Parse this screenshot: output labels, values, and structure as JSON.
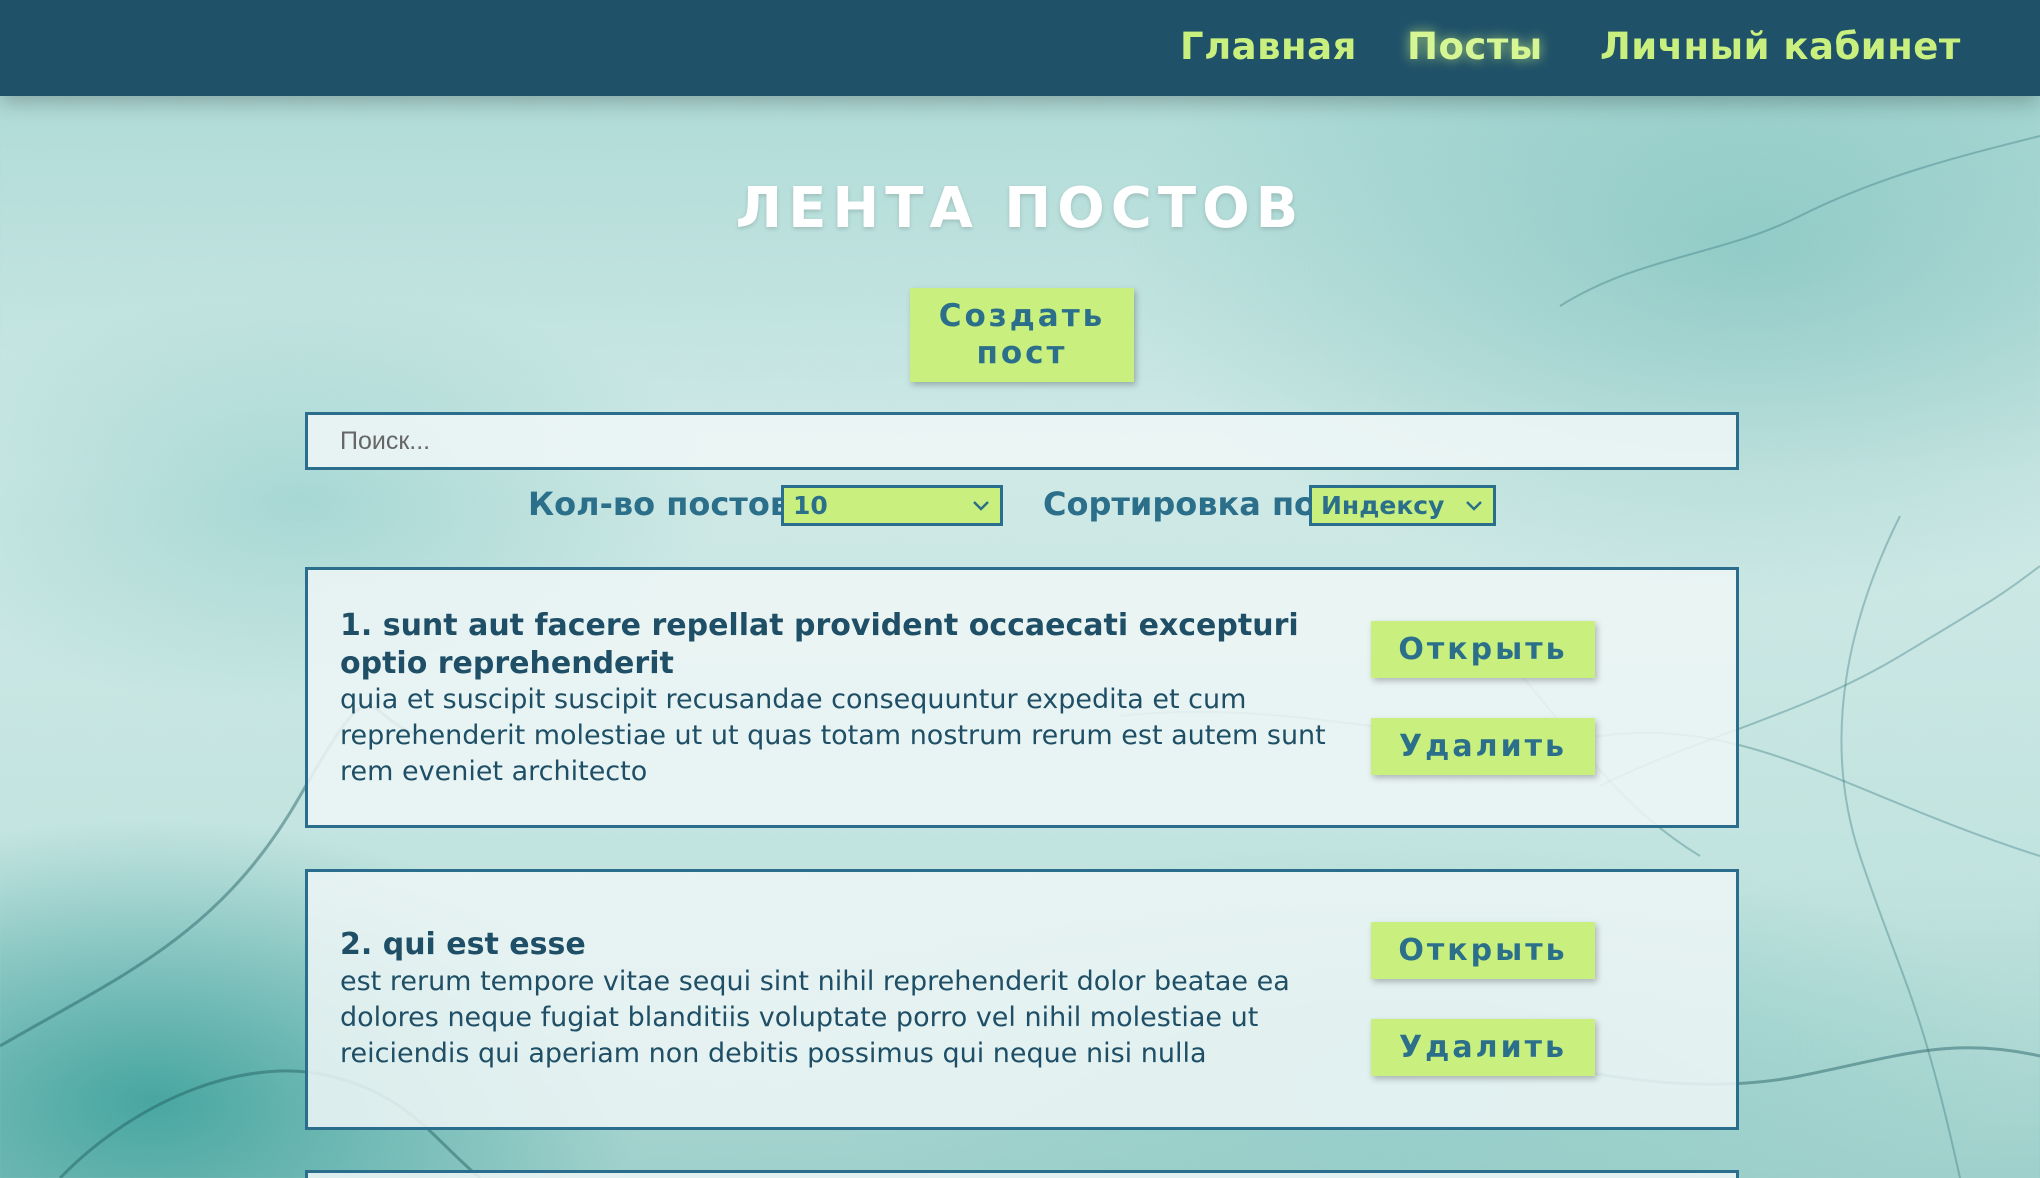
{
  "nav": {
    "items": [
      {
        "label": "Главная"
      },
      {
        "label": "Посты"
      },
      {
        "label": "Личный кабинет"
      }
    ],
    "active": "Посты"
  },
  "page": {
    "title": "ЛЕНТА ПОСТОВ",
    "create_button": "Создать пост"
  },
  "search": {
    "placeholder": "Поиск...",
    "value": ""
  },
  "filters": {
    "limit_label": "Кол-во постов",
    "limit_value": "10",
    "sort_label": "Сортировка по",
    "sort_value": "Индексу"
  },
  "posts": [
    {
      "title": "1. sunt aut facere repellat provident occaecati excepturi optio reprehenderit",
      "body": "quia et suscipit suscipit recusandae consequuntur expedita et cum reprehenderit molestiae ut ut quas totam nostrum rerum est autem sunt rem eveniet architecto",
      "open_label": "Открыть",
      "delete_label": "Удалить"
    },
    {
      "title": "2. qui est esse",
      "body": "est rerum tempore vitae sequi sint nihil reprehenderit dolor beatae ea dolores neque fugiat blanditiis voluptate porro vel nihil molestiae ut reiciendis qui aperiam non debitis possimus qui neque nisi nulla",
      "open_label": "Открыть",
      "delete_label": "Удалить"
    }
  ],
  "colors": {
    "navbar": "#1f5169",
    "accent": "#c9f07e",
    "border": "#2a6d8c",
    "text": "#1f4f66"
  }
}
